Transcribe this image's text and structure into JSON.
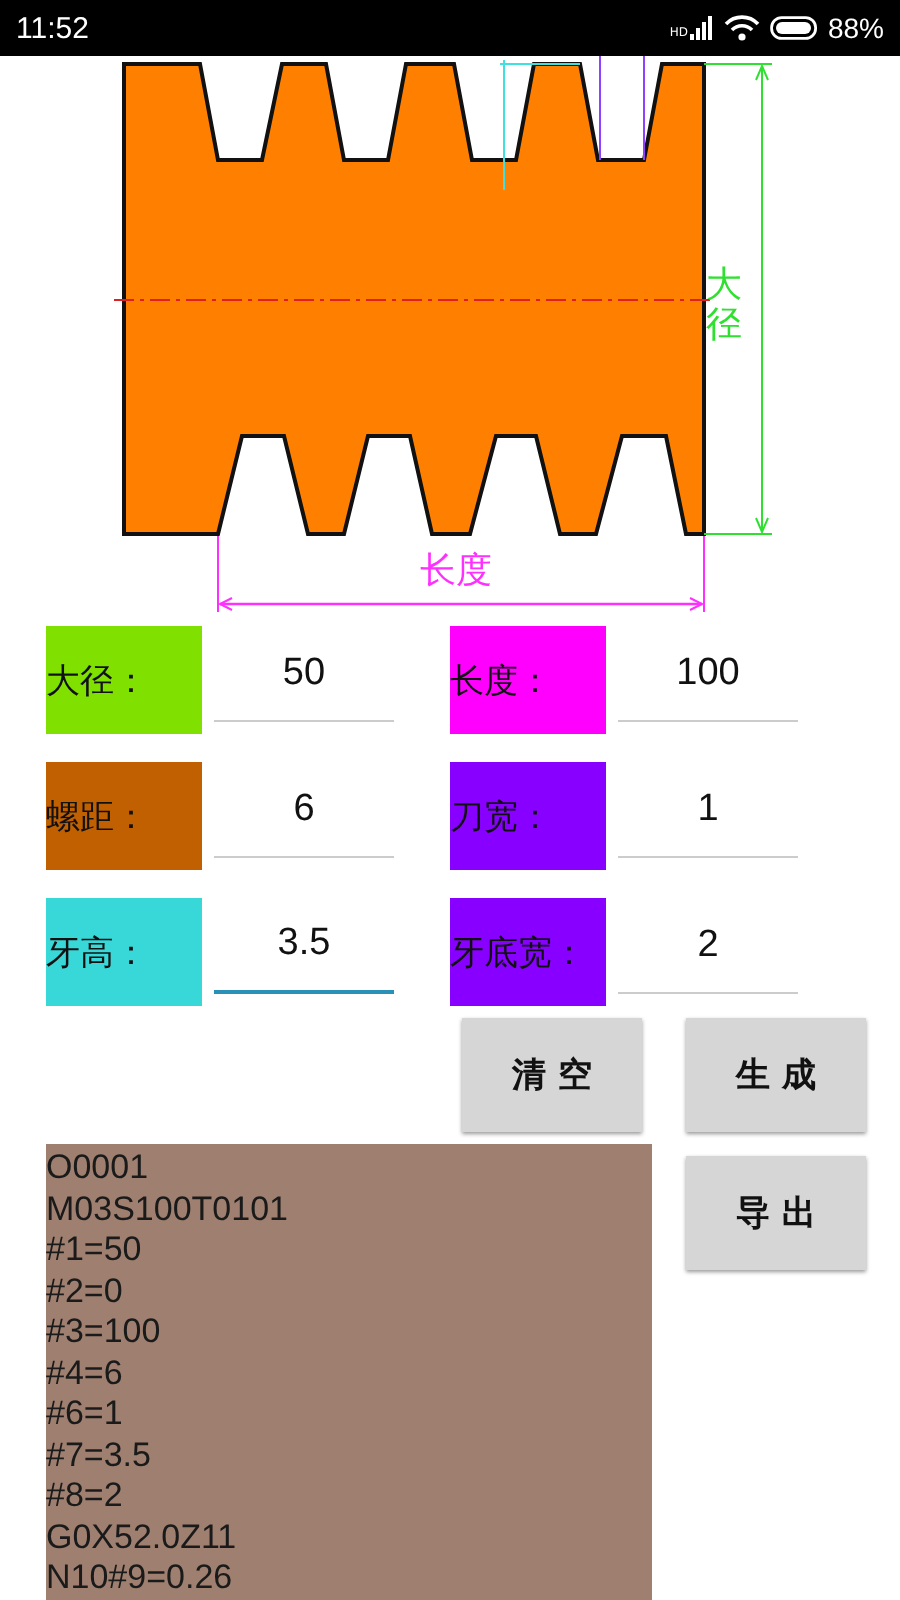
{
  "status_bar": {
    "time": "11:52",
    "network": "HD",
    "battery": "88%"
  },
  "diagram": {
    "diameter_label": "大径",
    "length_label": "长度"
  },
  "fields": [
    {
      "label": "大径：",
      "color": "#80e000",
      "value": "50",
      "focused": false
    },
    {
      "label": "长度：",
      "color": "#ff00ff",
      "value": "100",
      "focused": false
    },
    {
      "label": "螺距：",
      "color": "#c06000",
      "value": "6",
      "focused": false
    },
    {
      "label": "刀宽：",
      "color": "#8800ff",
      "value": "1",
      "focused": false
    },
    {
      "label": "牙高：",
      "color": "#38d8d8",
      "value": "3.5",
      "focused": true
    },
    {
      "label": "牙底宽：",
      "color": "#8800ff",
      "value": "2",
      "focused": false
    }
  ],
  "buttons": {
    "clear": "清 空",
    "generate": "生 成",
    "export": "导 出"
  },
  "code_lines": [
    "O0001",
    "M03S100T0101",
    "#1=50",
    "#2=0",
    "#3=100",
    "#4=6",
    "#6=1",
    "#7=3.5",
    "#8=2",
    "G0X52.0Z11",
    "N10#9=0.26"
  ]
}
